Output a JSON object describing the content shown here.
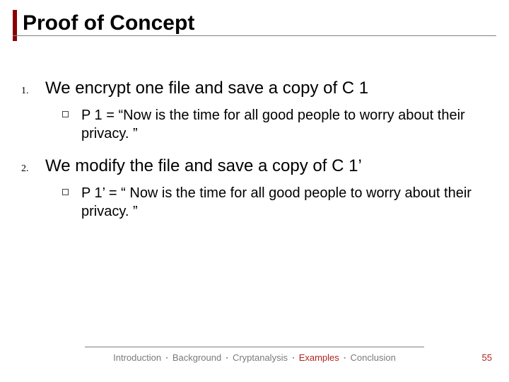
{
  "title": "Proof of Concept",
  "items": [
    {
      "num": "1.",
      "text": "We encrypt one file and save a copy of C 1",
      "sub": {
        "text": "P 1 = “Now is the time for all good people to worry about their privacy. ”"
      }
    },
    {
      "num": "2.",
      "text": "We modify the file and save a copy of C 1’",
      "sub": {
        "text": "P 1’ = “ Now is the time for all good people to worry about their privacy. ”"
      }
    }
  ],
  "breadcrumb": {
    "items": [
      "Introduction",
      "Background",
      "Cryptanalysis",
      "Examples",
      "Conclusion"
    ],
    "active_index": 3,
    "sep": "▪"
  },
  "page_number": "55"
}
